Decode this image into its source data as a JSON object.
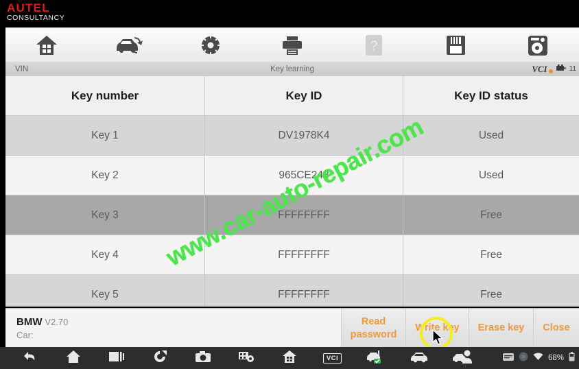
{
  "brand": {
    "name": "AUTEL",
    "subtitle": "CONSULTANCY",
    "color": "#e01b1b"
  },
  "toolbar": {
    "items": [
      {
        "icon": "home-icon",
        "label": "Home"
      },
      {
        "icon": "vehicle-swap-icon",
        "label": "Vehicle"
      },
      {
        "icon": "gear-icon",
        "label": "Settings"
      },
      {
        "icon": "printer-icon",
        "label": "Print"
      },
      {
        "icon": "help-icon",
        "label": "Help"
      },
      {
        "icon": "save-floppy-icon",
        "label": "Save"
      },
      {
        "icon": "data-logging-icon",
        "label": "Data logging"
      }
    ]
  },
  "statusbar": {
    "vin_label": "VIN",
    "title": "Key learning",
    "vci_label": "VCI",
    "battery_voltage": "11"
  },
  "table": {
    "headers": [
      "Key number",
      "Key ID",
      "Key ID status"
    ],
    "rows": [
      {
        "number": "Key 1",
        "id": "DV1978K4",
        "status": "Used",
        "selected": false
      },
      {
        "number": "Key 2",
        "id": "965CE248",
        "status": "Used",
        "selected": false
      },
      {
        "number": "Key 3",
        "id": "FFFFFFFF",
        "status": "Free",
        "selected": true
      },
      {
        "number": "Key 4",
        "id": "FFFFFFFF",
        "status": "Free",
        "selected": false
      },
      {
        "number": "Key 5",
        "id": "FFFFFFFF",
        "status": "Free",
        "selected": false
      }
    ]
  },
  "watermark": {
    "text": "www.car-auto-repair.com",
    "color": "#4ce54c"
  },
  "vehicle": {
    "make": "BMW",
    "version": "V2.70",
    "car_label": "Car:"
  },
  "actions": {
    "read_password": "Read password",
    "write_key": "Write key",
    "erase_key": "Erase key",
    "close": "Close",
    "accent_color": "#ef9a3d",
    "highlighted": "Write key"
  },
  "navbar": {
    "items": [
      {
        "icon": "back-icon"
      },
      {
        "icon": "home-icon"
      },
      {
        "icon": "recent-apps-icon"
      },
      {
        "icon": "rotate-refresh-icon"
      },
      {
        "icon": "camera-icon"
      },
      {
        "icon": "screenshot-settings-icon"
      },
      {
        "icon": "app-home-icon"
      },
      {
        "icon": "vci-badge-icon",
        "label": "VCI"
      },
      {
        "icon": "vci-connected-icon"
      },
      {
        "icon": "car-icon"
      },
      {
        "icon": "remote-support-icon"
      }
    ],
    "status": {
      "keyboard_icon": "keyboard-icon",
      "circle_icon": "circle-icon",
      "wifi_icon": "wifi-icon",
      "battery_percent": "68%",
      "battery_icon": "battery-icon"
    }
  }
}
